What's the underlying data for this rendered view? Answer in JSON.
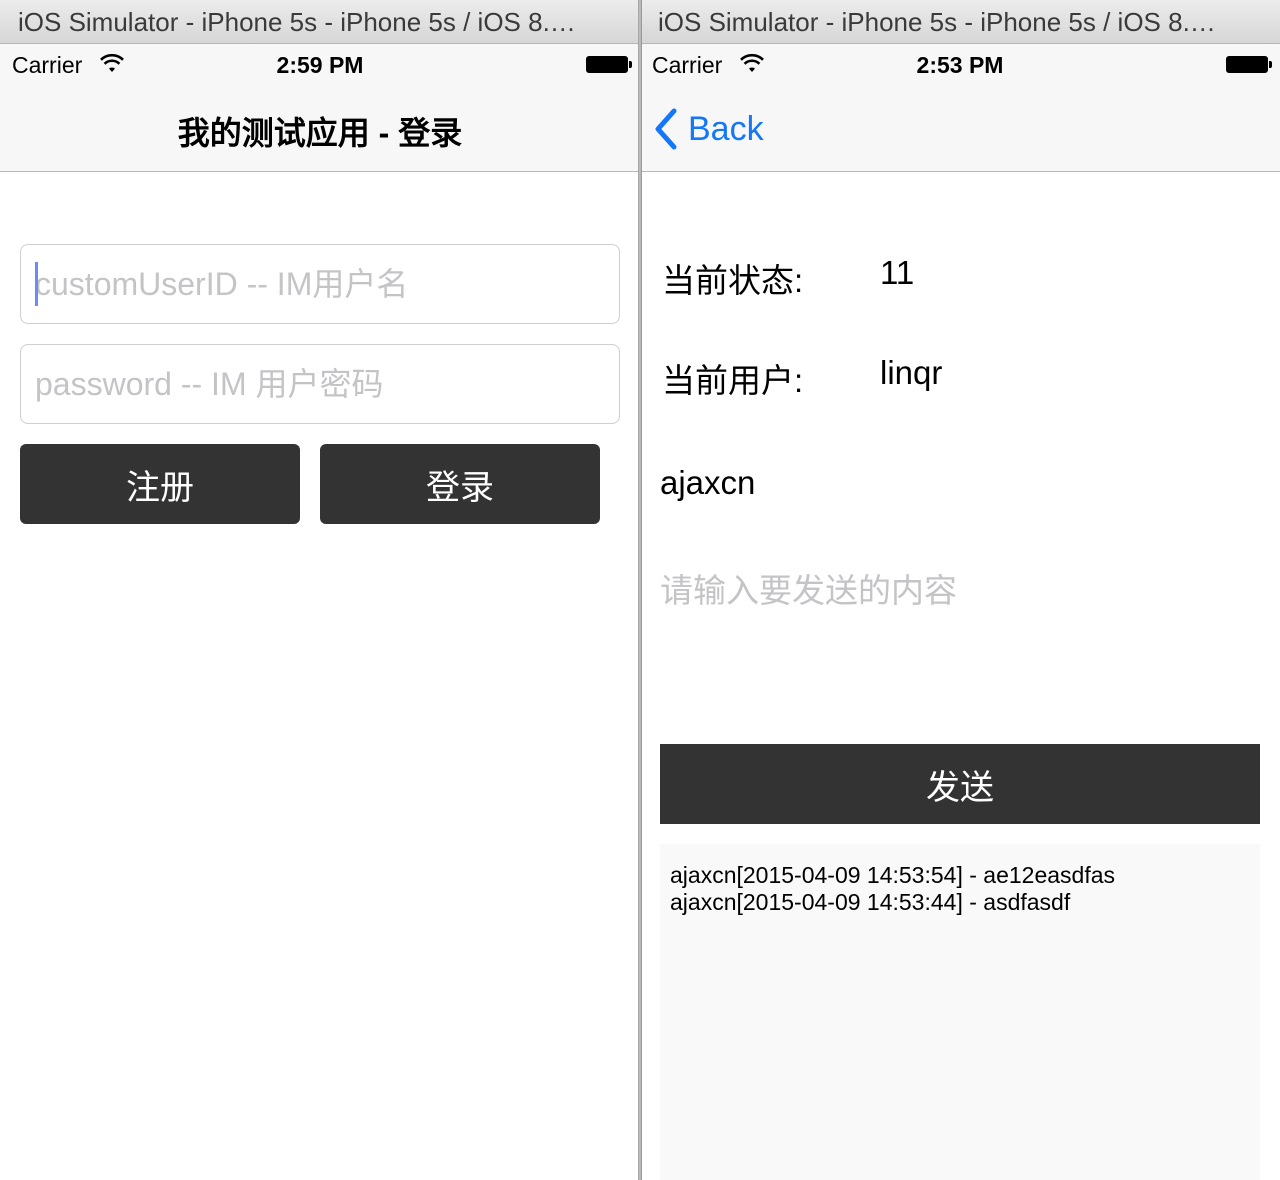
{
  "left": {
    "window_title": "iOS Simulator - iPhone 5s - iPhone 5s / iOS 8.…",
    "status": {
      "carrier": "Carrier",
      "time": "2:59 PM"
    },
    "nav": {
      "title": "我的测试应用 - 登录"
    },
    "form": {
      "user_placeholder": "customUserID -- IM用户名",
      "password_placeholder": "password -- IM 用户密码",
      "register_label": "注册",
      "login_label": "登录"
    }
  },
  "right": {
    "window_title": "iOS Simulator - iPhone 5s - iPhone 5s / iOS 8.…",
    "status": {
      "carrier": "Carrier",
      "time": "2:53 PM"
    },
    "nav": {
      "back_label": "Back"
    },
    "info": {
      "state_label": "当前状态:",
      "state_value": "11",
      "user_label": "当前用户:",
      "user_value": "linqr"
    },
    "target_user": "ajaxcn",
    "message_placeholder": "请输入要发送的内容",
    "send_label": "发送",
    "log": [
      "ajaxcn[2015-04-09 14:53:54] - ae12easdfas",
      "ajaxcn[2015-04-09 14:53:44] - asdfasdf"
    ]
  },
  "colors": {
    "accent": "#1477f8",
    "button_dark": "#333333",
    "placeholder": "#c4c4c7"
  }
}
